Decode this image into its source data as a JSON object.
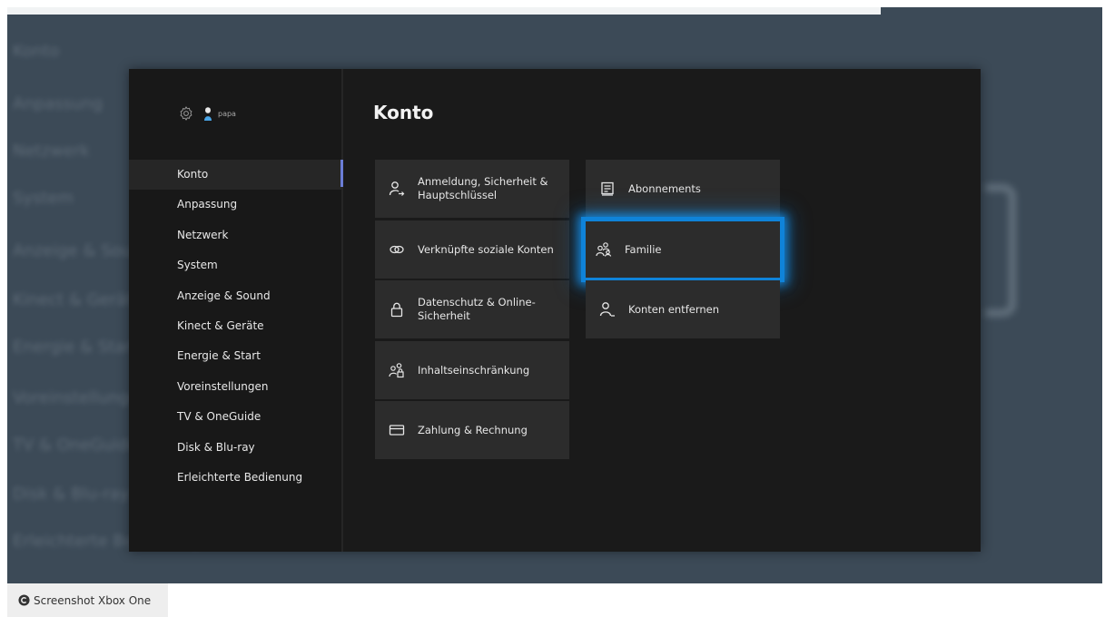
{
  "background": {
    "blurred_menu": [
      "Konto",
      "Anpassung",
      "Netzwerk",
      "System",
      "Anzeige & Sound",
      "Kinect & Geräte",
      "Energie & Start",
      "Voreinstellungen",
      "TV & OneGuide",
      "Disk & Blu-ray",
      "Erleichterte Bedienung"
    ]
  },
  "header": {
    "username": "papa",
    "settings_icon": "gear-icon",
    "avatar_icon": "avatar-icon"
  },
  "sidebar": {
    "selected_index": 0,
    "items": [
      {
        "label": "Konto"
      },
      {
        "label": "Anpassung"
      },
      {
        "label": "Netzwerk"
      },
      {
        "label": "System"
      },
      {
        "label": "Anzeige & Sound"
      },
      {
        "label": "Kinect & Geräte"
      },
      {
        "label": "Energie & Start"
      },
      {
        "label": "Voreinstellungen"
      },
      {
        "label": "TV & OneGuide"
      },
      {
        "label": "Disk & Blu-ray"
      },
      {
        "label": "Erleichterte Bedienung"
      }
    ]
  },
  "main": {
    "title": "Konto",
    "tiles": [
      {
        "label": "Anmeldung, Sicherheit & Hauptschlüssel",
        "icon": "person-key-icon"
      },
      {
        "label": "Verknüpfte soziale Konten",
        "icon": "link-icon"
      },
      {
        "label": "Datenschutz & Online-Sicherheit",
        "icon": "lock-icon"
      },
      {
        "label": "Inhaltseinschränkung",
        "icon": "people-lock-icon"
      },
      {
        "label": "Zahlung & Rechnung",
        "icon": "card-icon"
      },
      {
        "label": "Abonnements",
        "icon": "subscription-icon"
      },
      {
        "label": "Familie",
        "icon": "family-icon"
      },
      {
        "label": "Konten entfernen",
        "icon": "person-remove-icon"
      }
    ],
    "focused_tile": "Familie"
  },
  "colors": {
    "focus": "#0f83d9",
    "selection_bar": "#6b7dd6",
    "tile": "#2c2c2c",
    "screen": "#1a1a1a",
    "backdrop": "#3c4a57"
  },
  "caption": {
    "text": "Screenshot Xbox One",
    "icon": "copyright-icon"
  }
}
